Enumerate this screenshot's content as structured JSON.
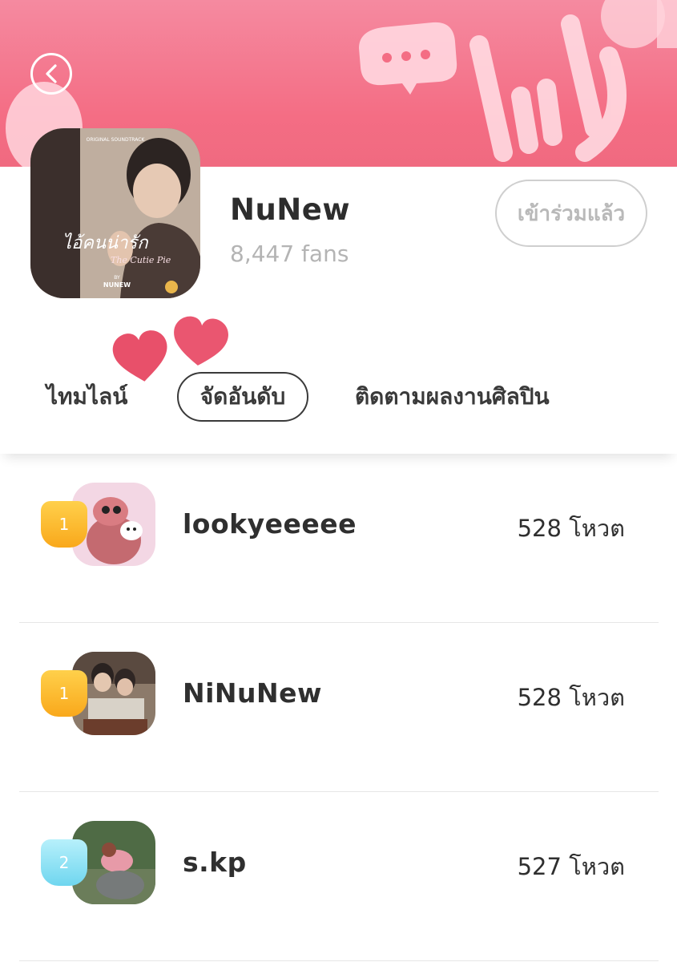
{
  "header": {
    "back_icon": "chevron-left-icon"
  },
  "artist": {
    "cover_icon": "album-cover-image",
    "cover_title": "ไอ้คนน่ารัก",
    "cover_subtitle": "The Cutie Pie",
    "cover_top": "ORIGINAL SOUNDTRACK",
    "cover_by": "BY",
    "cover_artist": "NUNEW",
    "name": "NuNew",
    "fans": "8,447 fans",
    "joined_label": "เข้าร่วมแล้ว"
  },
  "tabs": {
    "timeline": "ไทมไลน์",
    "ranking": "จัดอันดับ",
    "follow": "ติดตามผลงานศิลปิน",
    "active": "ranking"
  },
  "ranking": [
    {
      "rank": "1",
      "badge_color": "#f9b428",
      "name": "lookyeeeee",
      "votes": "528 โหวต"
    },
    {
      "rank": "1",
      "badge_color": "#f9b428",
      "name": "NiNuNew",
      "votes": "528 โหวต"
    },
    {
      "rank": "2",
      "badge_color": "#7fdcf1",
      "name": "s.kp",
      "votes": "527 โหวต"
    }
  ],
  "colors": {
    "accent": "#f46d84",
    "heart": "#e8506a"
  }
}
